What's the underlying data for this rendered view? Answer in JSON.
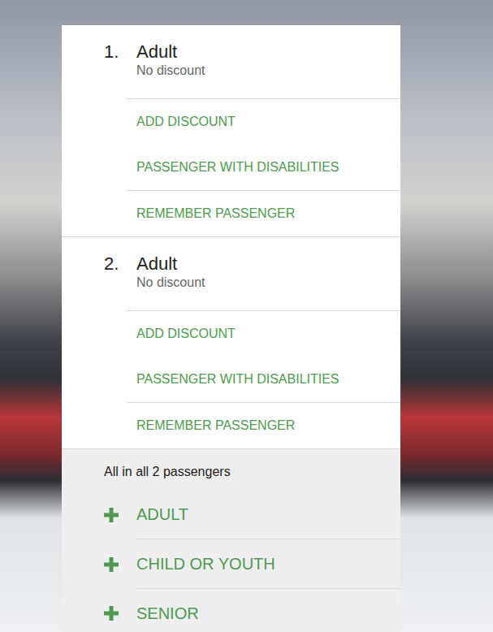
{
  "passengers": [
    {
      "number": "1.",
      "type": "Adult",
      "discount": "No discount",
      "action_groups": [
        [
          "ADD DISCOUNT",
          "PASSENGER WITH DISABILITIES"
        ],
        [
          "REMEMBER PASSENGER"
        ]
      ]
    },
    {
      "number": "2.",
      "type": "Adult",
      "discount": "No discount",
      "action_groups": [
        [
          "ADD DISCOUNT",
          "PASSENGER WITH DISABILITIES"
        ],
        [
          "REMEMBER PASSENGER"
        ]
      ]
    }
  ],
  "summary": "All in all 2 passengers",
  "add_options": [
    "ADULT",
    "CHILD OR YOUTH",
    "SENIOR"
  ]
}
